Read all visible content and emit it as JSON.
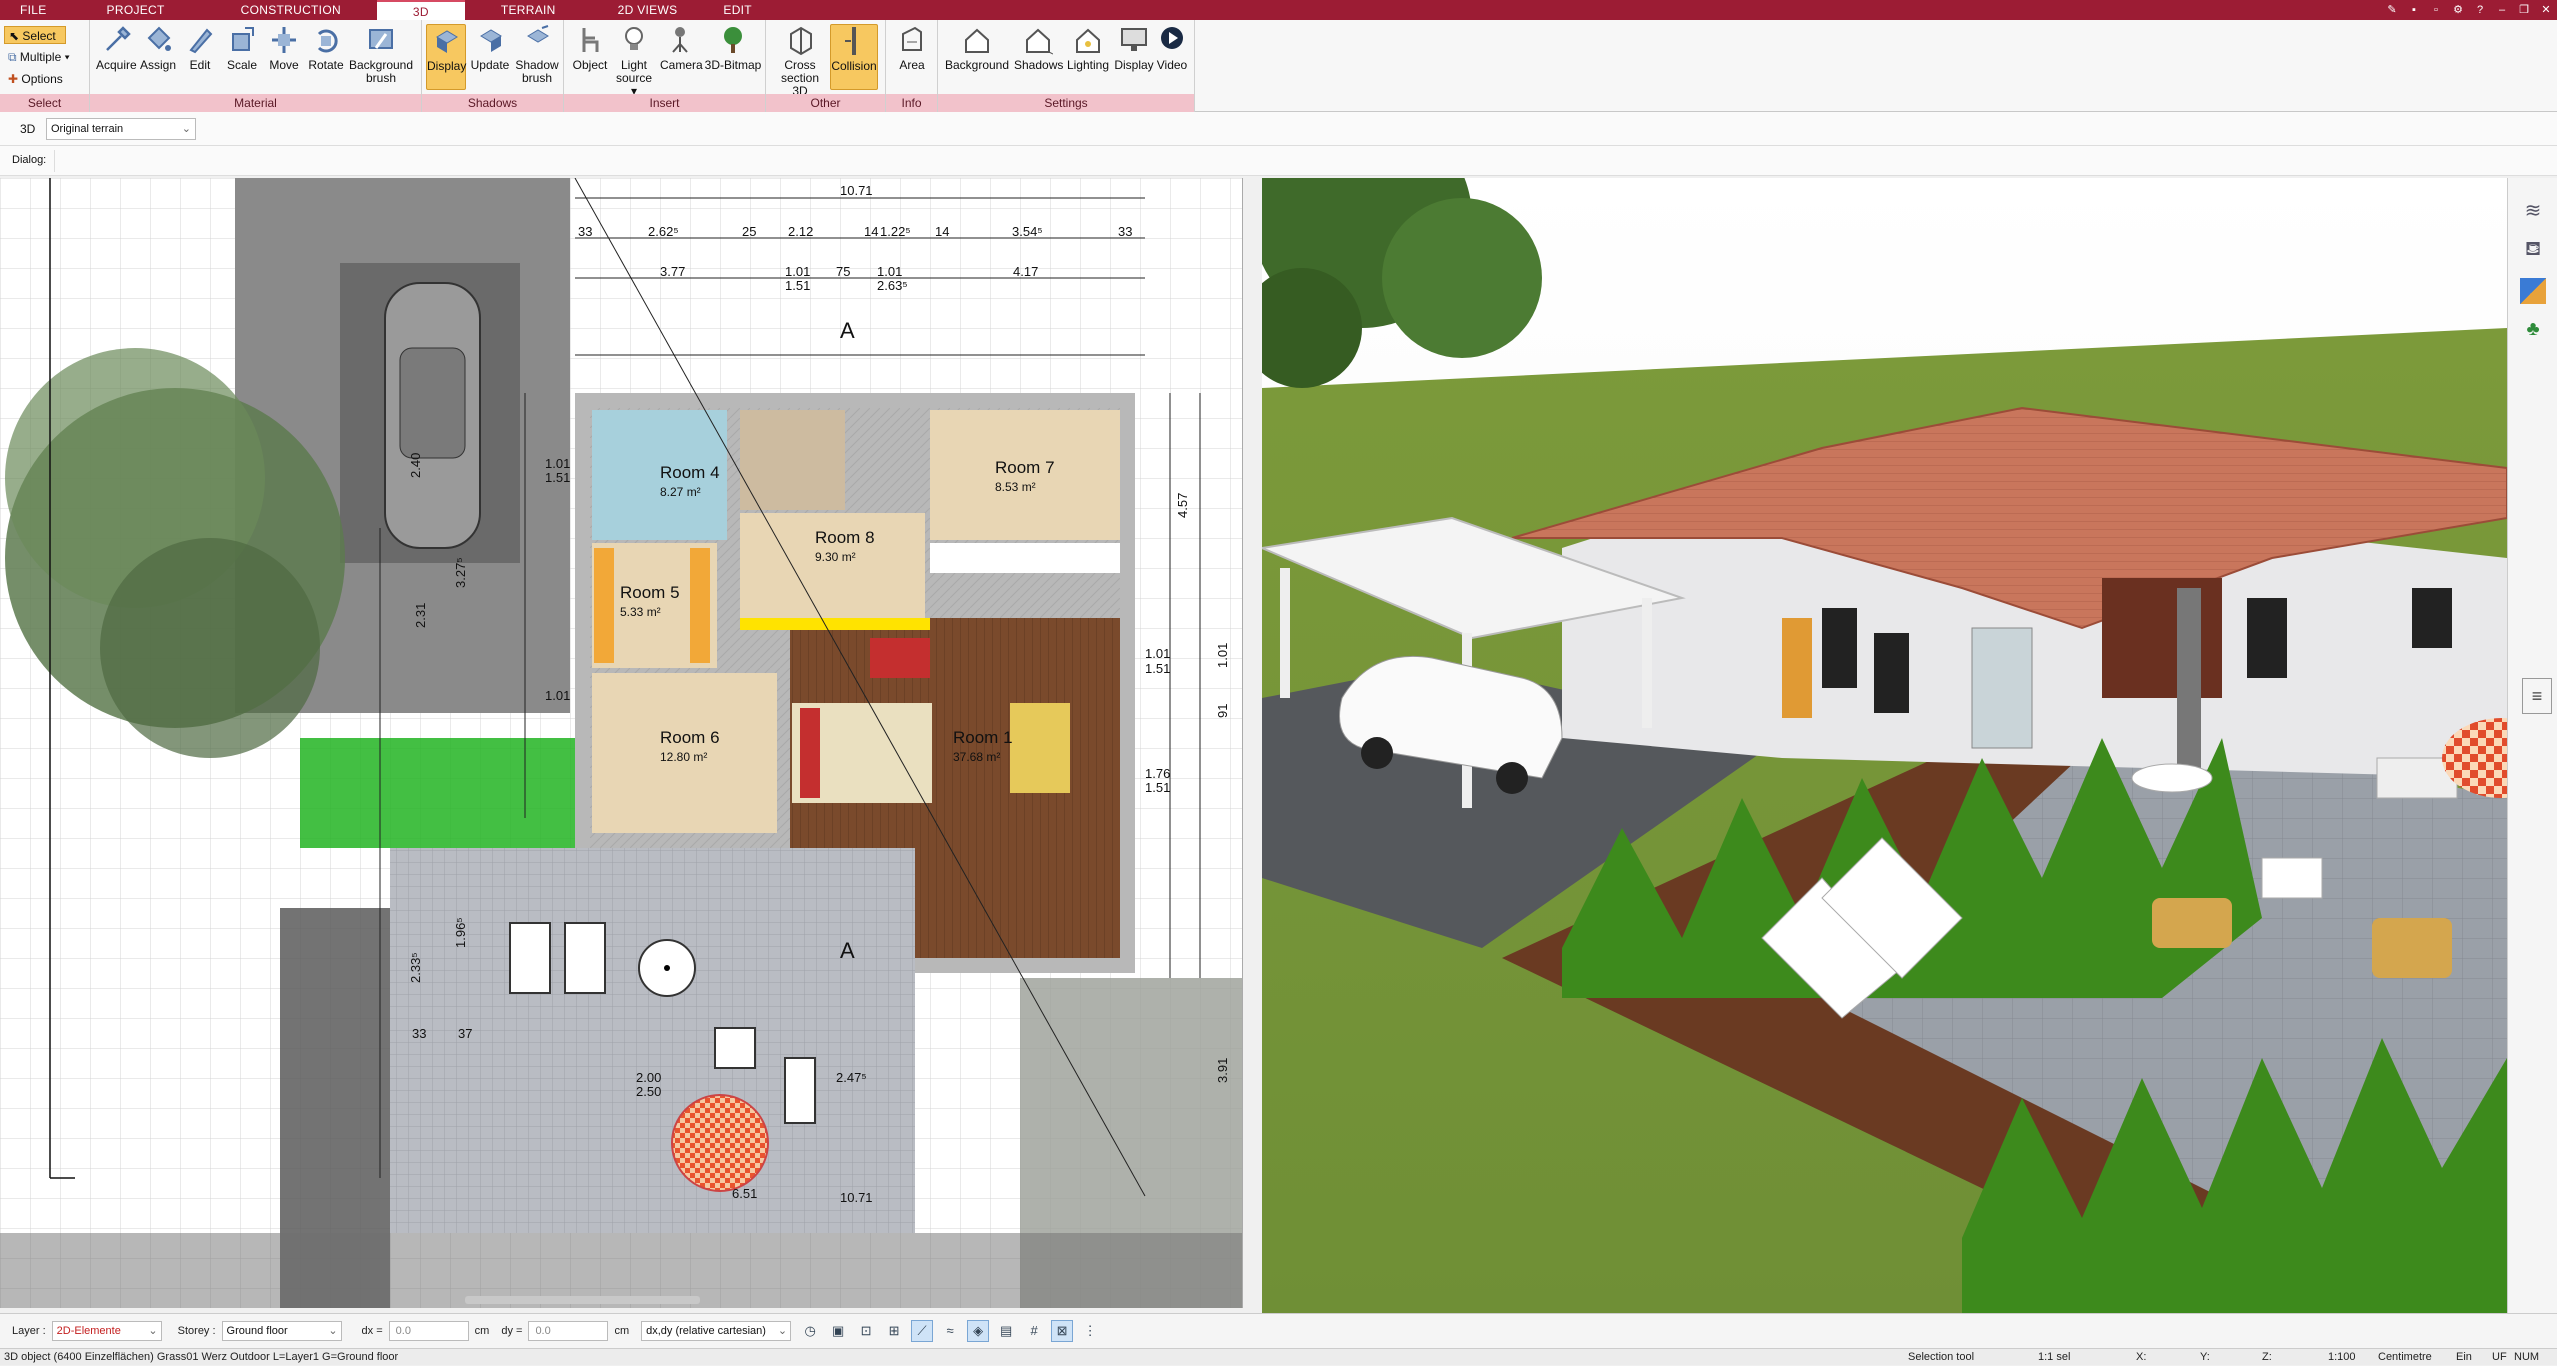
{
  "menu": {
    "tabs": [
      "FILE",
      "PROJECT",
      "CONSTRUCTION",
      "3D",
      "TERRAIN",
      "2D VIEWS",
      "EDIT"
    ],
    "active": "3D"
  },
  "ribbon": {
    "select": {
      "select_label": "Select",
      "multiple_label": "Multiple",
      "options_label": "Options",
      "group": "Select"
    },
    "material": {
      "group": "Material",
      "buttons": [
        "Acquire",
        "Assign",
        "Edit",
        "Scale",
        "Move",
        "Rotate",
        "Background brush"
      ]
    },
    "shadows": {
      "group": "Shadows",
      "buttons": [
        "Display",
        "Update",
        "Shadow brush"
      ]
    },
    "insert": {
      "group": "Insert",
      "buttons": [
        "Object",
        "Light source",
        "Camera",
        "3D-Bitmap"
      ]
    },
    "other": {
      "group": "Other",
      "buttons": [
        "Cross section 3D",
        "Collision"
      ]
    },
    "info": {
      "group": "Info",
      "buttons": [
        "Area"
      ]
    },
    "settings": {
      "group": "Settings",
      "buttons": [
        "Background",
        "Shadows",
        "Lighting",
        "Display",
        "Video"
      ]
    }
  },
  "subbar": {
    "mode": "3D",
    "terrain_value": "Original terrain"
  },
  "dialog": {
    "label": "Dialog:"
  },
  "plan": {
    "dims_top": [
      "10.71",
      "33",
      "2.62⁵",
      "25",
      "2.12",
      "14",
      "1.22⁵",
      "14",
      "3.54⁵",
      "33",
      "3.77",
      "1.01",
      "1.51",
      "75",
      "1.01",
      "2.63⁵",
      "4.17"
    ],
    "rooms": [
      {
        "name": "Room 4",
        "area": "8.27 m²"
      },
      {
        "name": "Room 7",
        "area": "8.53 m²"
      },
      {
        "name": "Room 8",
        "area": "9.30 m²"
      },
      {
        "name": "Room 5",
        "area": "5.33 m²"
      },
      {
        "name": "Room 6",
        "area": "12.80 m²"
      },
      {
        "name": "Room 1",
        "area": "37.68 m²"
      }
    ],
    "dims_bottom": [
      "2.00",
      "2.50",
      "2.47⁵",
      "10.71",
      "6.51"
    ],
    "dims_right": [
      "4.57",
      "1.01",
      "1.51",
      "1.01",
      "91",
      "1.76",
      "1.51",
      "3.91"
    ],
    "dims_left": [
      "1.01",
      "1.51",
      "2.40",
      "3.27⁵",
      "2.31",
      "1.01",
      "2.33⁵",
      "1.96⁵",
      "33",
      "37"
    ],
    "section_label": "A"
  },
  "bottom": {
    "layer_label": "Layer :",
    "layer_value": "2D-Elemente",
    "storey_label": "Storey :",
    "storey_value": "Ground floor",
    "dx_label": "dx =",
    "dx_value": "0.0",
    "dy_label": "dy =",
    "dy_value": "0.0",
    "unit": "cm",
    "coord_mode": "dx,dy (relative cartesian)"
  },
  "status": {
    "object_info": "3D object (6400 Einzelflächen) Grass01 Werz Outdoor L=Layer1 G=Ground floor",
    "tool": "Selection tool",
    "sel": "1:1 sel",
    "x": "X:",
    "y": "Y:",
    "z": "Z:",
    "scale": "1:100",
    "unit": "Centimetre",
    "ein": "Ein",
    "uf": "UF",
    "num": "NUM"
  },
  "colors": {
    "brand": "#9c1c34",
    "active_button": "#f7c860",
    "group_title": "#f2c2cb"
  }
}
